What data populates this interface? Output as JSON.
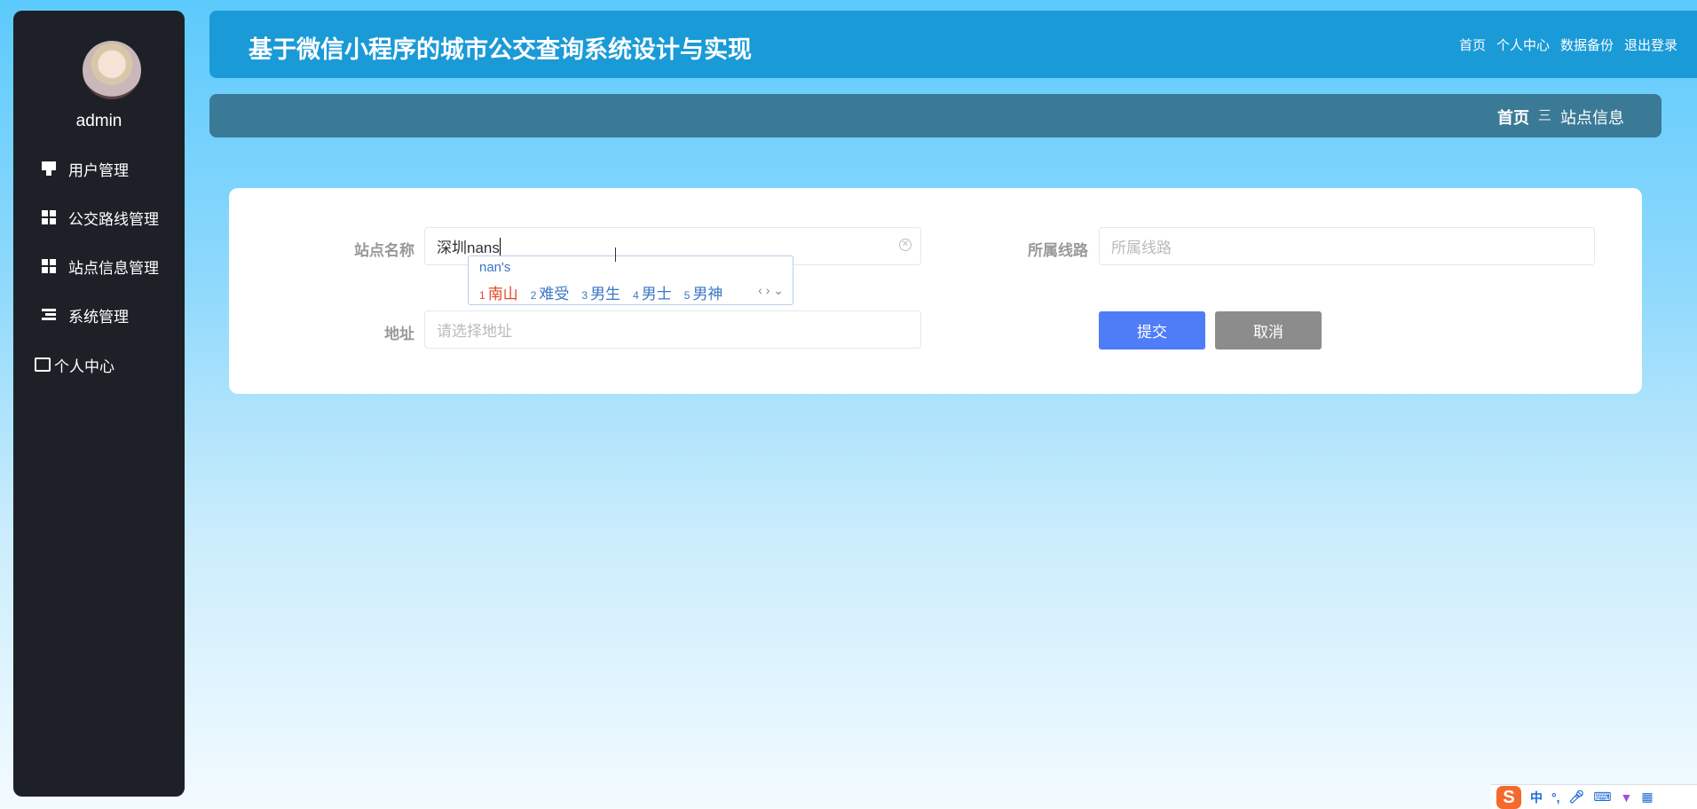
{
  "sidebar": {
    "username": "admin",
    "items": [
      {
        "label": "用户管理",
        "icon": "user-manage-icon"
      },
      {
        "label": "公交路线管理",
        "icon": "grid-icon"
      },
      {
        "label": "站点信息管理",
        "icon": "grid-icon"
      },
      {
        "label": "系统管理",
        "icon": "list-icon"
      },
      {
        "label": "个人中心",
        "icon": "card-icon"
      }
    ]
  },
  "header": {
    "title": "基于微信小程序的城市公交查询系统设计与实现",
    "links": [
      "首页",
      "个人中心",
      "数据备份",
      "退出登录"
    ]
  },
  "breadcrumb": {
    "home": "首页",
    "separator": "三",
    "current": "站点信息"
  },
  "form": {
    "station_name": {
      "label": "站点名称",
      "value": "深圳nans"
    },
    "route": {
      "label": "所属线路",
      "placeholder": "所属线路"
    },
    "address": {
      "label": "地址",
      "placeholder": "请选择地址"
    },
    "submit": "提交",
    "cancel": "取消"
  },
  "ime": {
    "pinyin": "nan's",
    "candidates": [
      {
        "n": "1",
        "t": "南山"
      },
      {
        "n": "2",
        "t": "难受"
      },
      {
        "n": "3",
        "t": "男生"
      },
      {
        "n": "4",
        "t": "男士"
      },
      {
        "n": "5",
        "t": "男神"
      }
    ],
    "nav": "‹ › ⌄"
  },
  "taskbar": {
    "ime_logo": "S",
    "mode": "中",
    "punct": "°,",
    "items": [
      "mic-icon",
      "keyboard-icon",
      "skin-icon",
      "apps-icon"
    ]
  },
  "colors": {
    "sidebar": "#1d2127",
    "header": "#1a9ad7",
    "breadcrumb": "#3b7a96",
    "submit": "#4f7cf7",
    "cancel": "#8c8c8c"
  }
}
